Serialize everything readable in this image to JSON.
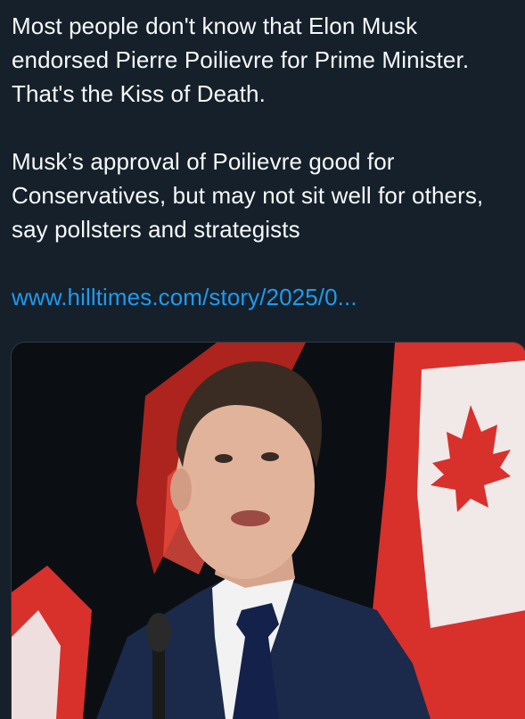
{
  "post": {
    "text_line_1": "Most people don't know that Elon Musk endorsed Pierre Poilievre for Prime Minister. That's the Kiss of Death.",
    "text_line_2": "Musk’s approval of Poilievre good for Conservatives, but may not sit well for others, say pollsters and strategists",
    "link_text": "www.hilltimes.com/story/2025/0..."
  },
  "media": {
    "image": "man-in-suit-speaking-in-front-of-canadian-flags-photo",
    "colors": {
      "flag_red": "#d8302b",
      "flag_white": "#f2f2f2",
      "background": "#0b0f14",
      "suit": "#1b2a4a",
      "tie": "#14214a"
    }
  },
  "theme": {
    "background": "#15202b",
    "text": "#f7f9f9",
    "link": "#1d9bf0"
  }
}
